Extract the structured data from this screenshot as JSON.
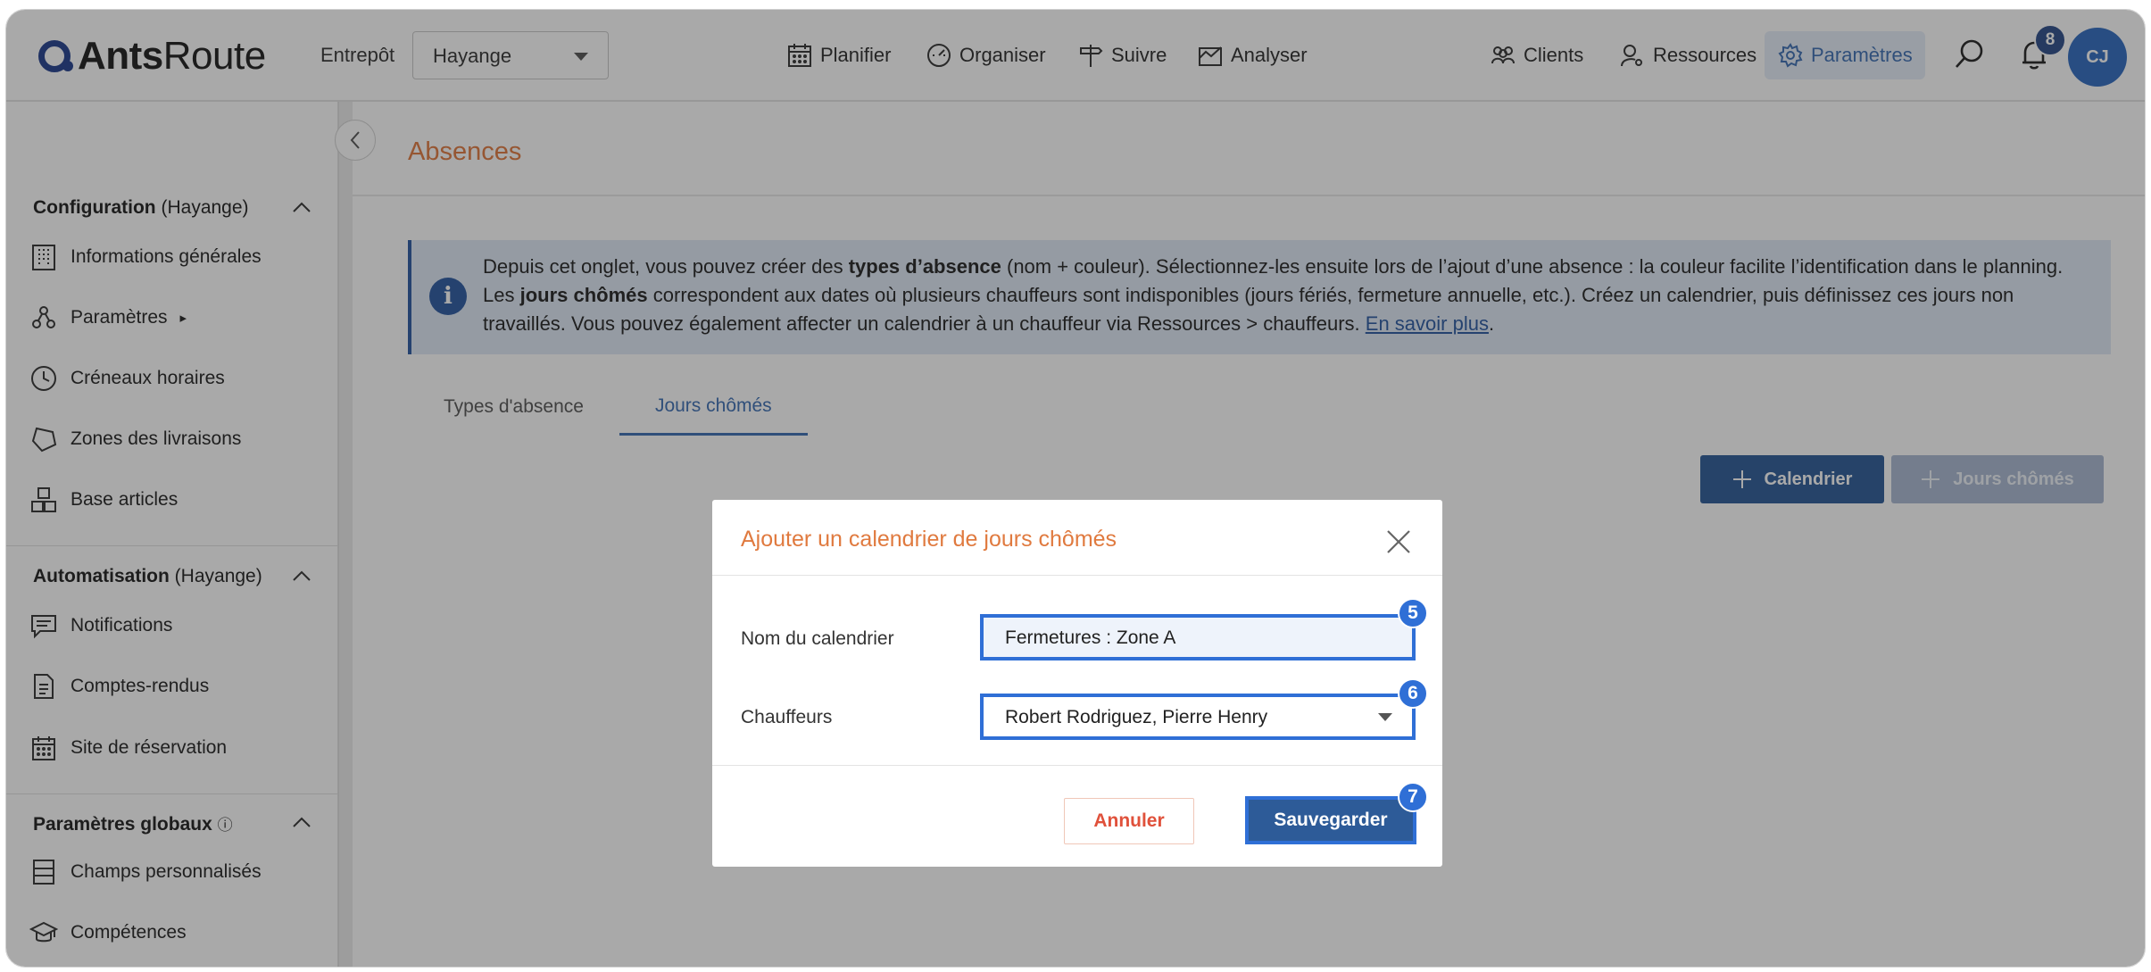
{
  "app": {
    "logo_bold": "Ants",
    "logo_light": "Route"
  },
  "header": {
    "entrepot_label": "Entrepôt",
    "entrepot_value": "Hayange",
    "nav": {
      "planifier": "Planifier",
      "organiser": "Organiser",
      "suivre": "Suivre",
      "analyser": "Analyser",
      "clients": "Clients",
      "ressources": "Ressources",
      "parametres": "Paramètres"
    },
    "notification_count": "8",
    "avatar_initials": "CJ",
    "active_color": "#3d6fb4"
  },
  "sidebar": {
    "configuration": {
      "title": "Configuration",
      "context": " (Hayange)",
      "items": [
        {
          "label": "Informations générales",
          "icon": "building-icon"
        },
        {
          "label": "Paramètres",
          "suffix": "▸",
          "icon": "settings-nodes-icon"
        },
        {
          "label": "Créneaux horaires",
          "icon": "clock-icon"
        },
        {
          "label": "Zones des livraisons",
          "icon": "polygon-zone-icon"
        },
        {
          "label": "Base articles",
          "icon": "boxes-icon"
        }
      ]
    },
    "automatisation": {
      "title": "Automatisation",
      "context": " (Hayange)",
      "items": [
        {
          "label": "Notifications",
          "icon": "message-icon"
        },
        {
          "label": "Comptes-rendus",
          "icon": "document-icon"
        },
        {
          "label": "Site de réservation",
          "icon": "calendar-icon"
        }
      ]
    },
    "globaux": {
      "title": "Paramètres globaux",
      "info": "ⓘ",
      "items": [
        {
          "label": "Champs personnalisés",
          "icon": "custom-fields-icon"
        },
        {
          "label": "Compétences",
          "icon": "graduation-cap-icon"
        }
      ]
    }
  },
  "page": {
    "title": "Absences",
    "info": {
      "part1": "Depuis cet onglet, vous pouvez créer des ",
      "bold1": "types d’absence",
      "part2": " (nom + couleur). Sélectionnez-les ensuite lors de l’ajout d’une absence : la couleur facilite l’identification dans le planning. Les ",
      "bold2": "jours chômés",
      "part3": " correspondent aux dates où plusieurs chauffeurs sont indisponibles (jours fériés, fermeture annuelle, etc.). Créez un calendrier, puis définissez ces jours non travaillés. Vous pouvez également affecter un calendrier à un chauffeur via Ressources > chauffeurs. ",
      "link": "En savoir plus",
      "end": "."
    },
    "tabs": [
      "Types d'absence",
      "Jours chômés"
    ],
    "active_tab": "Jours chômés",
    "btn_calendrier": "Calendrier",
    "btn_jours_chomes": "Jours chômés"
  },
  "modal": {
    "title": "Ajouter un calendrier de jours chômés",
    "name_label": "Nom du calendrier",
    "name_value": "Fermetures : Zone A",
    "drivers_label": "Chauffeurs",
    "drivers_value": "Robert Rodriguez, Pierre Henry",
    "cancel": "Annuler",
    "save": "Sauvegarder",
    "steps": [
      "5",
      "6",
      "7"
    ],
    "accent_title": "#e07a3f",
    "highlight": "#2f6fd6"
  }
}
